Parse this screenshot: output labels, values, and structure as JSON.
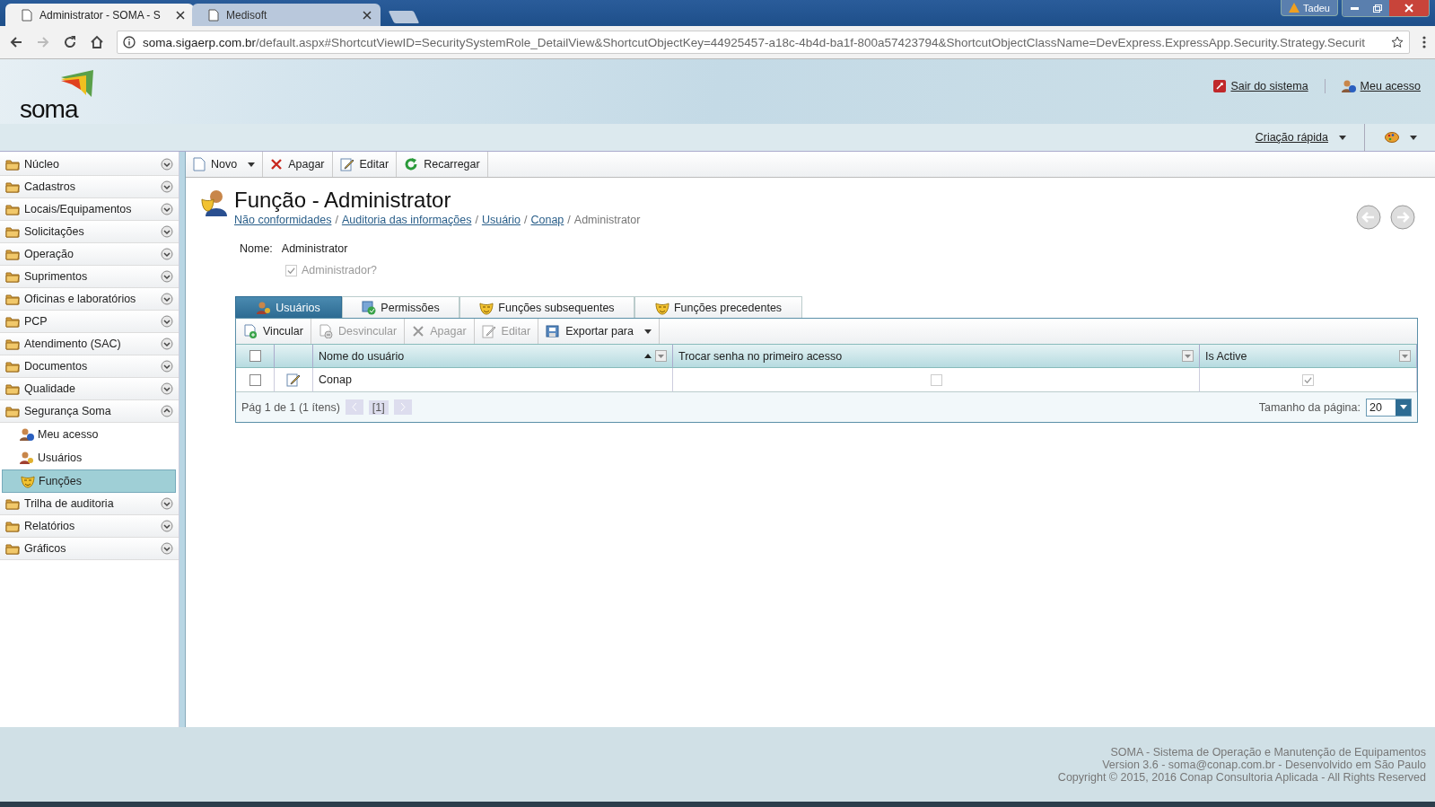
{
  "browser": {
    "tabs": [
      {
        "title": "Administrator - SOMA - S",
        "selected": true
      },
      {
        "title": "Medisoft",
        "selected": false
      }
    ],
    "user_badge": "Tadeu",
    "url_host": "soma.sigaerp.com.br",
    "url_path": "/default.aspx#ShortcutViewID=SecuritySystemRole_DetailView&ShortcutObjectKey=44925457-a18c-4b4d-ba1f-800a57423794&ShortcutObjectClassName=DevExpress.ExpressApp.Security.Strategy.Securit"
  },
  "header": {
    "logo": "soma",
    "links": [
      "Sair do sistema",
      "Meu acesso"
    ],
    "quick_create": "Criação rápida"
  },
  "sidebar": {
    "items": [
      {
        "label": "Núcleo",
        "expanded": false
      },
      {
        "label": "Cadastros",
        "expanded": false
      },
      {
        "label": "Locais/Equipamentos",
        "expanded": false
      },
      {
        "label": "Solicitações",
        "expanded": false
      },
      {
        "label": "Operação",
        "expanded": false
      },
      {
        "label": "Suprimentos",
        "expanded": false
      },
      {
        "label": "Oficinas e laboratórios",
        "expanded": false
      },
      {
        "label": "PCP",
        "expanded": false
      },
      {
        "label": "Atendimento (SAC)",
        "expanded": false
      },
      {
        "label": "Documentos",
        "expanded": false
      },
      {
        "label": "Qualidade",
        "expanded": false
      },
      {
        "label": "Segurança Soma",
        "expanded": true,
        "children": [
          {
            "label": "Meu acesso",
            "selected": false
          },
          {
            "label": "Usuários",
            "selected": false
          },
          {
            "label": "Funções",
            "selected": true
          }
        ]
      },
      {
        "label": "Trilha de auditoria",
        "expanded": false
      },
      {
        "label": "Relatórios",
        "expanded": false
      },
      {
        "label": "Gráficos",
        "expanded": false
      }
    ]
  },
  "toolbar": [
    {
      "label": "Novo",
      "dropdown": true
    },
    {
      "label": "Apagar",
      "dropdown": false
    },
    {
      "label": "Editar",
      "dropdown": false
    },
    {
      "label": "Recarregar",
      "dropdown": false
    }
  ],
  "detail": {
    "title": "Função - Administrator",
    "breadcrumb": [
      {
        "label": "Não conformidades",
        "kind": "link"
      },
      {
        "label": "/",
        "kind": "separator"
      },
      {
        "label": "Auditoria das informações",
        "kind": "link"
      },
      {
        "label": "/",
        "kind": "separator"
      },
      {
        "label": "Usuário",
        "kind": "link"
      },
      {
        "label": "/",
        "kind": "separator"
      },
      {
        "label": "Conap",
        "kind": "link"
      },
      {
        "label": "/",
        "kind": "separator"
      },
      {
        "label": "Administrator",
        "kind": "current"
      }
    ],
    "name_label": "Nome:",
    "name_value": "Administrator",
    "admin_checkbox": {
      "label": "Administrador?",
      "checked": true,
      "disabled": true
    }
  },
  "tabs": [
    {
      "label": "Usuários",
      "selected": true
    },
    {
      "label": "Permissões",
      "selected": false
    },
    {
      "label": "Funções subsequentes",
      "selected": false
    },
    {
      "label": "Funções precedentes",
      "selected": false
    }
  ],
  "grid": {
    "toolbar": [
      {
        "label": "Vincular",
        "disabled": false,
        "dropdown": false
      },
      {
        "label": "Desvincular",
        "disabled": true,
        "dropdown": false
      },
      {
        "label": "Apagar",
        "disabled": true,
        "dropdown": false
      },
      {
        "label": "Editar",
        "disabled": true,
        "dropdown": false
      },
      {
        "label": "Exportar para",
        "disabled": false,
        "dropdown": true
      }
    ],
    "select_all": false,
    "columns": [
      {
        "label": "Nome do usuário",
        "sorted": true
      },
      {
        "label": "Trocar senha no primeiro acesso",
        "sorted": false
      },
      {
        "label": "Is Active",
        "sorted": false
      }
    ],
    "rows": [
      {
        "selected": false,
        "name": "Conap",
        "change_password": false,
        "is_active": true
      }
    ],
    "pager": {
      "summary": "Pág 1 de 1 (1 ítens)",
      "page": "[1]",
      "page_size_label": "Tamanho da página:",
      "page_size": "20"
    }
  },
  "footer": [
    "SOMA - Sistema de Operação e Manutenção de Equipamentos",
    "Version 3.6 - soma@conap.com.br - Desenvolvido em São Paulo",
    "Copyright © 2015, 2016 Conap Consultoria Aplicada - All Rights Reserved"
  ]
}
